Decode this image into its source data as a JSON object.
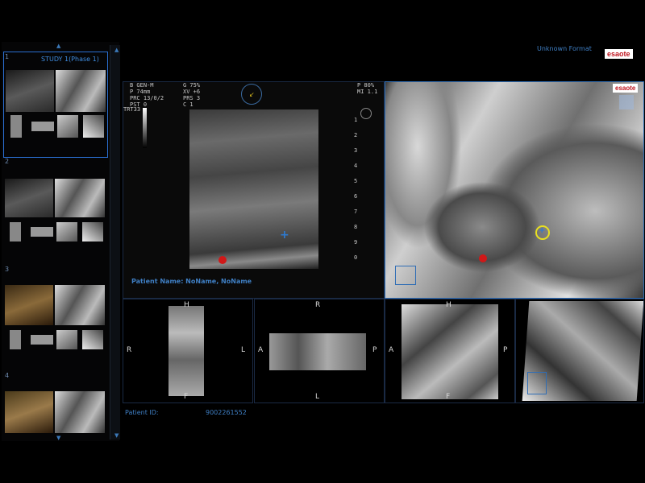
{
  "header": {
    "format_label": "Unknown Format",
    "logo_text": "esaote",
    "panel_logo_text": "esaote"
  },
  "studies": [
    {
      "number": "1",
      "title": "STUDY 1(Phase 1)",
      "selected": true
    },
    {
      "number": "2"
    },
    {
      "number": "3"
    },
    {
      "number": "4"
    }
  ],
  "ultrasound": {
    "info_left": [
      "B GEN-M",
      "P 74mm",
      "PRC 13/0/2",
      "PST 0"
    ],
    "info_mid": [
      "G 75%",
      "XV +6",
      "PRS 3",
      "C 1"
    ],
    "info_right": [
      "P 80%",
      "MI 1.1"
    ],
    "probe_label": "TRT33",
    "depth_scale": [
      "1",
      "2",
      "3",
      "4",
      "5",
      "6",
      "7",
      "8",
      "9",
      "0"
    ],
    "patient_name": "Patient Name: NoName, NoName"
  },
  "footer": {
    "patient_id_label": "Patient ID:",
    "patient_id_value": "9002261552"
  },
  "orientation": {
    "p1": {
      "top": "H",
      "left": "R",
      "right": "L",
      "bottom": "F"
    },
    "p2": {
      "top": "R",
      "left": "A",
      "right": "P",
      "bottom": "L"
    },
    "p3": {
      "top": "H",
      "left": "A",
      "right": "P",
      "bottom": "F"
    }
  },
  "colors": {
    "accent": "#2f6db5",
    "label_blue": "#3f7fc4",
    "marker_red": "#d01818",
    "cursor_yellow": "#e8e020"
  }
}
